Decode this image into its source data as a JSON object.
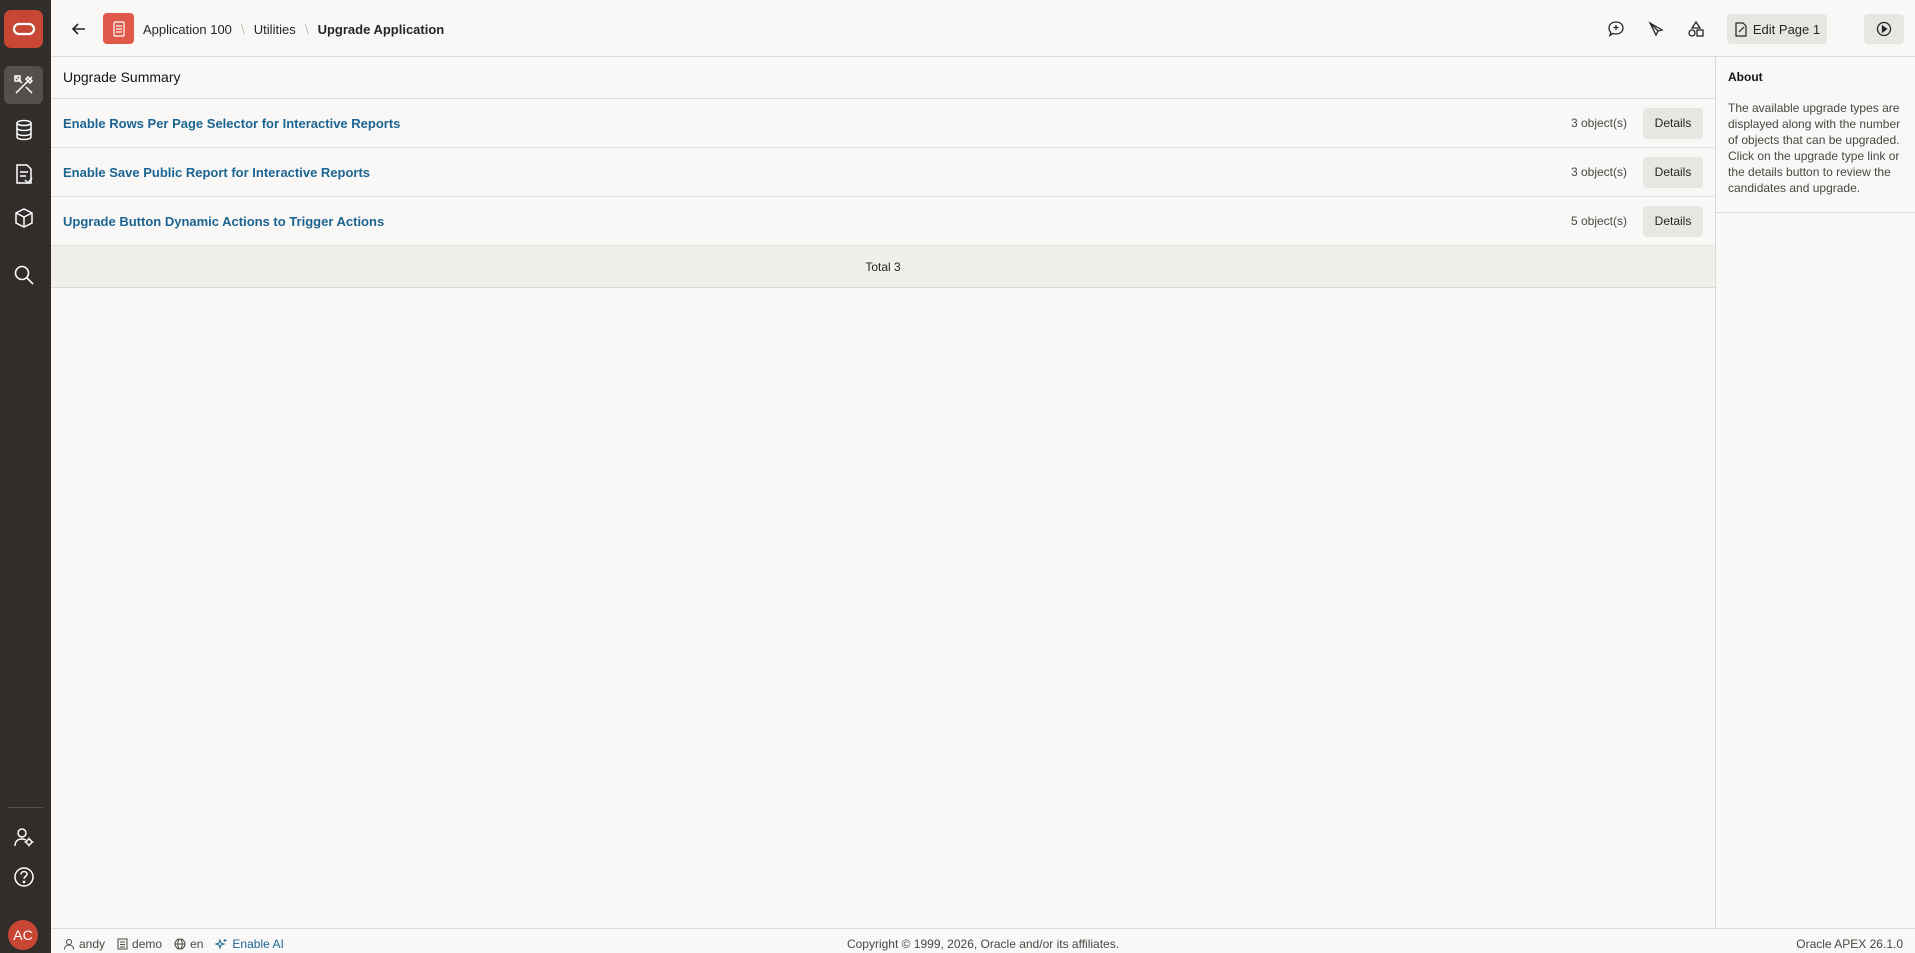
{
  "header": {
    "breadcrumb": [
      "Application 100",
      "Utilities",
      "Upgrade Application"
    ],
    "edit_label": "Edit Page 1"
  },
  "main": {
    "region_title": "Upgrade Summary",
    "rows": [
      {
        "label": "Enable Rows Per Page Selector for Interactive Reports",
        "count": "3 object(s)",
        "button": "Details"
      },
      {
        "label": "Enable Save Public Report for Interactive Reports",
        "count": "3 object(s)",
        "button": "Details"
      },
      {
        "label": "Upgrade Button Dynamic Actions to Trigger Actions",
        "count": "5 object(s)",
        "button": "Details"
      }
    ],
    "total": "Total 3"
  },
  "side": {
    "title": "About",
    "text": "The available upgrade types are displayed along with the number of objects that can be upgraded. Click on the upgrade type link or the details button to review the candidates and upgrade."
  },
  "nav": {
    "avatar": "AC",
    "icons": [
      "app-builder-icon",
      "sql-workshop-icon",
      "team-development-icon",
      "gallery-icon",
      "search-icon",
      "administration-icon",
      "help-icon"
    ]
  },
  "footer": {
    "user": "andy",
    "workspace": "demo",
    "language": "en",
    "ai_label": "Enable AI",
    "copyright": "Copyright © 1999, 2026, Oracle and/or its affiliates.",
    "version": "Oracle APEX 26.1.0"
  },
  "colors": {
    "brand": "#c74634",
    "nav_bg": "#312d2a",
    "link": "#1c6592"
  }
}
